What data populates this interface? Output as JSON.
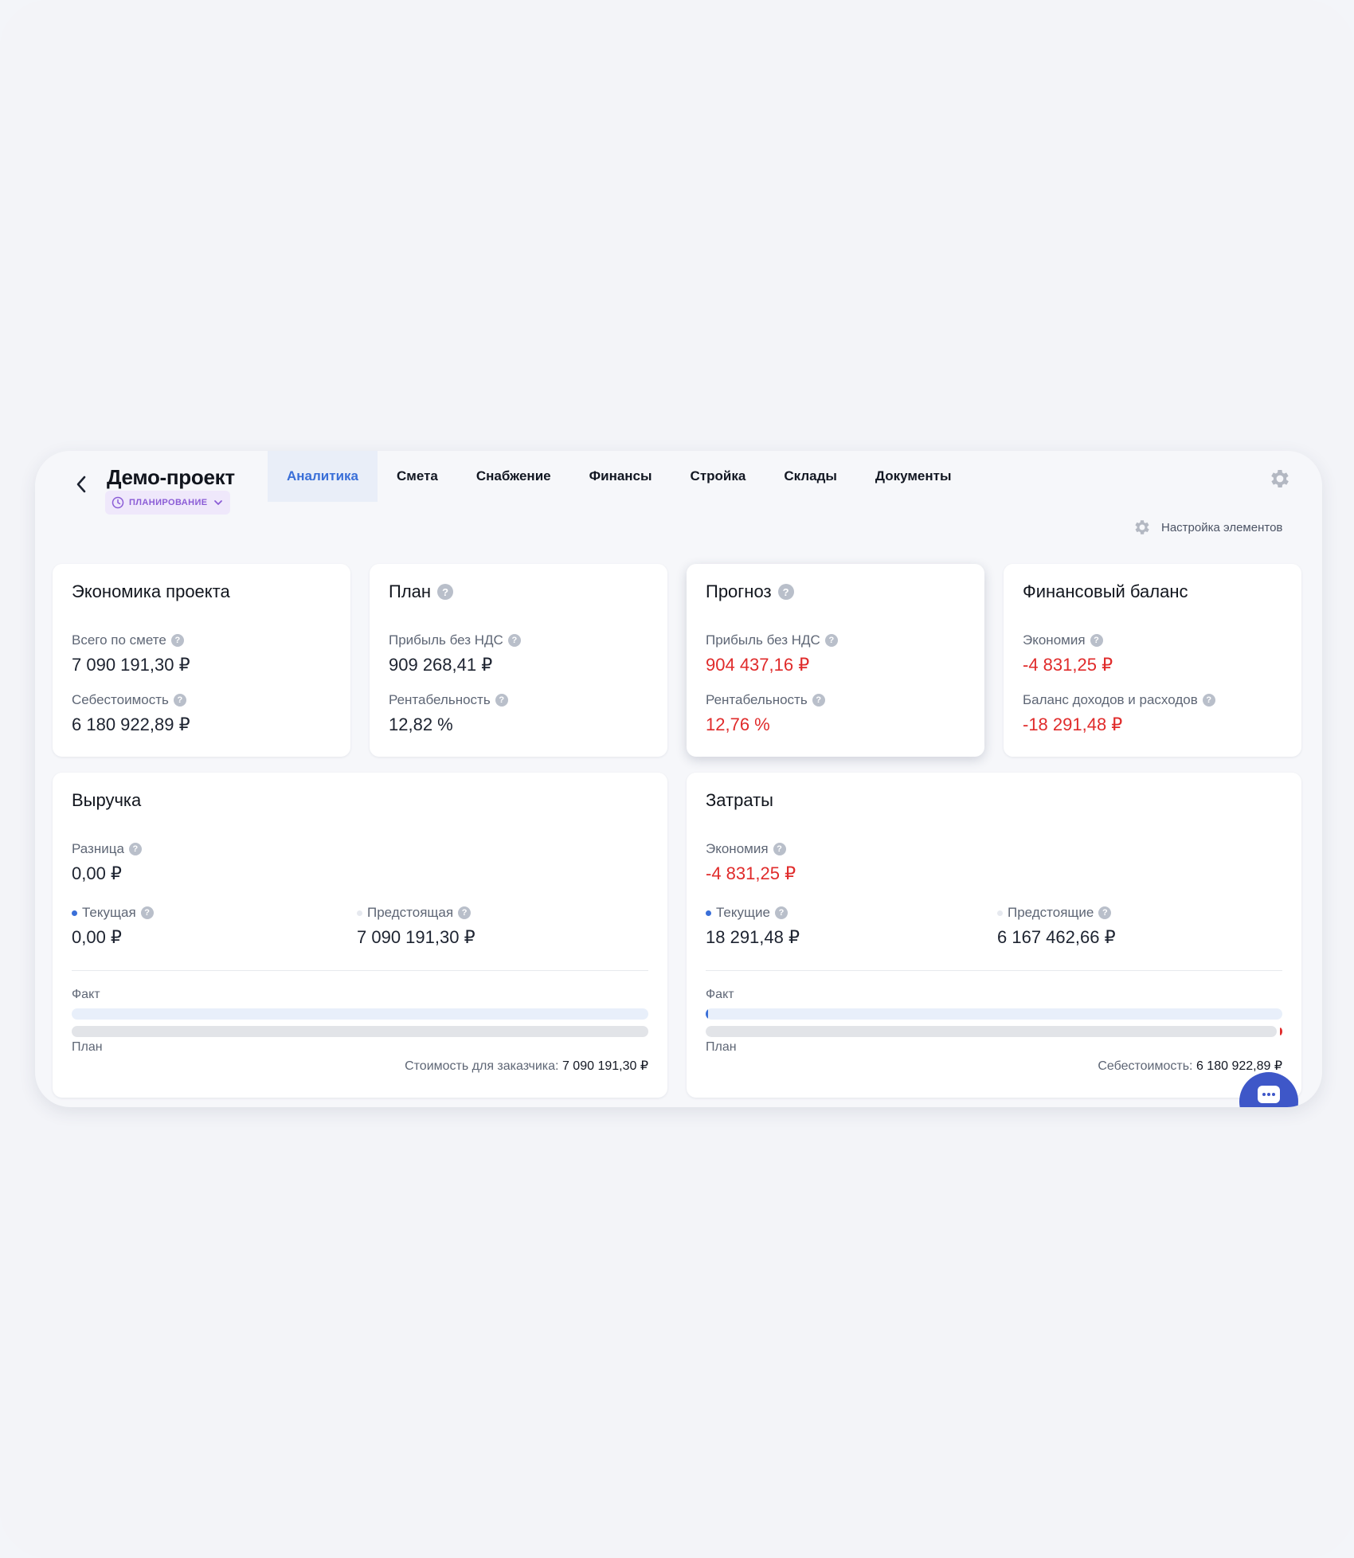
{
  "header": {
    "project_title": "Демо-проект",
    "status": "ПЛАНИРОВАНИЕ",
    "tabs": [
      {
        "label": "Аналитика",
        "active": true
      },
      {
        "label": "Смета"
      },
      {
        "label": "Снабжение"
      },
      {
        "label": "Финансы"
      },
      {
        "label": "Стройка"
      },
      {
        "label": "Склады"
      },
      {
        "label": "Документы"
      }
    ],
    "element_settings": "Настройка элементов"
  },
  "economics": {
    "title": "Экономика проекта",
    "total_label": "Всего по смете",
    "total_value": "7 090 191,30 ₽",
    "cost_label": "Себестоимость",
    "cost_value": "6 180 922,89 ₽"
  },
  "plan": {
    "title": "План",
    "profit_label": "Прибыль без НДС",
    "profit_value": "909 268,41 ₽",
    "margin_label": "Рентабельность",
    "margin_value": "12,82 %"
  },
  "forecast": {
    "title": "Прогноз",
    "profit_label": "Прибыль без НДС",
    "profit_value": "904 437,16 ₽",
    "margin_label": "Рентабельность",
    "margin_value": "12,76 %"
  },
  "balance": {
    "title": "Финансовый баланс",
    "savings_label": "Экономия",
    "savings_value": "-4 831,25 ₽",
    "cashflow_label": "Баланс доходов и расходов",
    "cashflow_value": "-18 291,48 ₽"
  },
  "revenue": {
    "title": "Выручка",
    "diff_label": "Разница",
    "diff_value": "0,00 ₽",
    "current_label": "Текущая",
    "current_value": "0,00 ₽",
    "upcoming_label": "Предстоящая",
    "upcoming_value": "7 090 191,30 ₽",
    "fact_label": "Факт",
    "plan_label": "План",
    "fact_progress": 0,
    "plan_progress": 1,
    "footer_label": "Стоимость для заказчика:",
    "footer_value": "7 090 191,30 ₽"
  },
  "costs": {
    "title": "Затраты",
    "savings_label": "Экономия",
    "savings_value": "-4 831,25 ₽",
    "current_label": "Текущие",
    "current_value": "18 291,48 ₽",
    "upcoming_label": "Предстоящие",
    "upcoming_value": "6 167 462,66 ₽",
    "fact_label": "Факт",
    "plan_label": "План",
    "fact_progress": 0.003,
    "plan_progress": 0.99,
    "footer_label": "Себестоимость:",
    "footer_value": "6 180 922,89 ₽"
  },
  "colors": {
    "accent": "#3a6fd8",
    "negative": "#e02b2b",
    "status": "#8b5cd6"
  },
  "icons": [
    "chevron-left-icon",
    "clock-icon",
    "chevron-down-icon",
    "gear-icon",
    "help-icon",
    "chat-icon"
  ]
}
